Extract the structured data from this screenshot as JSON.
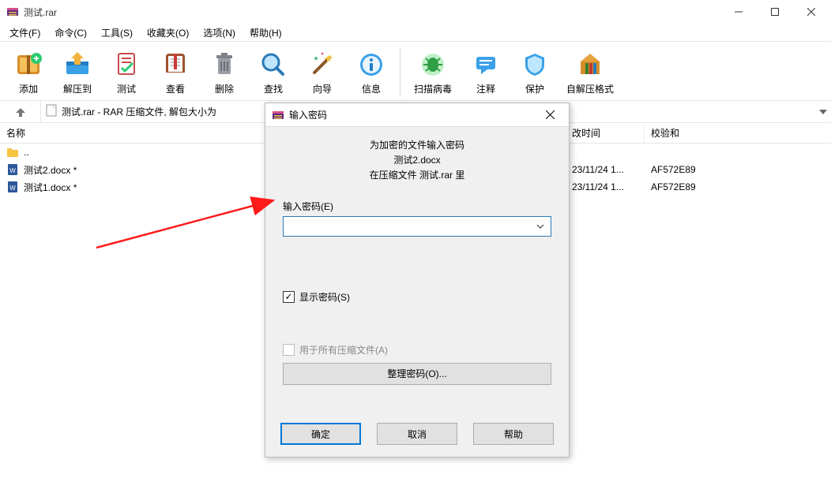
{
  "window": {
    "title": "测试.rar"
  },
  "menu": {
    "file": "文件(F)",
    "commands": "命令(C)",
    "tools": "工具(S)",
    "favorites": "收藏夹(O)",
    "options": "选项(N)",
    "help": "帮助(H)"
  },
  "toolbar": {
    "add": "添加",
    "extract_to": "解压到",
    "test": "测试",
    "view": "查看",
    "delete": "删除",
    "find": "查找",
    "wizard": "向导",
    "info": "信息",
    "virus_scan": "扫描病毒",
    "comment": "注释",
    "protect": "保护",
    "sfx": "自解压格式"
  },
  "pathbar": {
    "text": "测试.rar - RAR 压缩文件, 解包大小为"
  },
  "columns": {
    "name": "名称",
    "mtime_partial_header": "改时间",
    "crc": "校验和"
  },
  "rows": {
    "up": "..",
    "r1": {
      "name": "测试2.docx *",
      "mtime": "23/11/24 1...",
      "crc": "AF572E89"
    },
    "r2": {
      "name": "测试1.docx *",
      "mtime": "23/11/24 1...",
      "crc": "AF572E89"
    }
  },
  "dialog": {
    "title": "输入密码",
    "heading_l1": "为加密的文件输入密码",
    "heading_l2": "测试2.docx",
    "heading_l3": "在压缩文件 测试.rar 里",
    "password_label": "输入密码(E)",
    "password_value": "",
    "show_password": "显示密码(S)",
    "use_for_all": "用于所有压缩文件(A)",
    "organize": "整理密码(O)...",
    "ok": "确定",
    "cancel": "取消",
    "help": "帮助"
  }
}
